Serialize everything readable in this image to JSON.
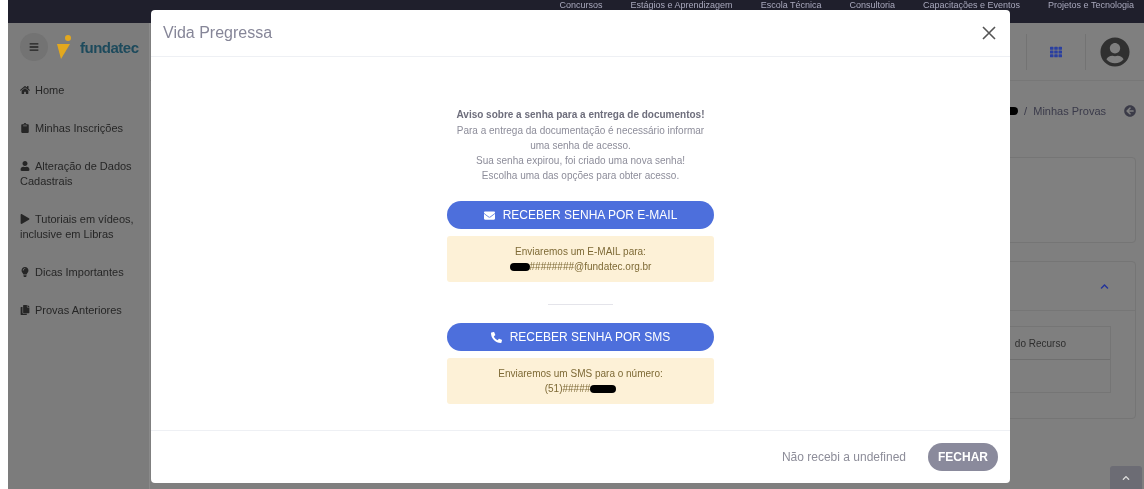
{
  "top_nav": [
    "Concursos",
    "Estágios e Aprendizagem",
    "Escola Técnica",
    "Consultoria",
    "Capacitações e Eventos",
    "Projetos e Tecnologia"
  ],
  "logo": "fundatec",
  "sidebar": {
    "items": [
      {
        "label": "Home"
      },
      {
        "label": "Minhas Inscrições"
      },
      {
        "label": "Alteração de Dados Cadastrais"
      },
      {
        "label": "Tutoriais em vídeos, inclusive em Libras"
      },
      {
        "label": "Dicas Importantes"
      },
      {
        "label": "Provas Anteriores"
      }
    ]
  },
  "breadcrumb": {
    "current": "/  Minhas Provas"
  },
  "background_table": {
    "column_header": "do Recurso"
  },
  "modal": {
    "title": "Vida Pregressa",
    "notice": {
      "heading": "Aviso sobre a senha para a entrega de documentos!",
      "lines": [
        "Para a entrega da documentação é necessário informar uma senha de acesso.",
        "Sua senha expirou, foi criado uma nova senha!",
        "Escolha uma das opções para obter acesso."
      ]
    },
    "options": [
      {
        "kind": "email",
        "button": "RECEBER SENHA POR E-MAIL",
        "info": "Enviaremos um E-MAIL para:",
        "contact": "########@fundatec.org.br"
      },
      {
        "kind": "sms",
        "button": "RECEBER SENHA POR SMS",
        "info": "Enviaremos um SMS para o número:",
        "contact": "(51)#####"
      }
    ],
    "footer": {
      "link": "Não recebi a undefined",
      "close": "FECHAR"
    }
  }
}
